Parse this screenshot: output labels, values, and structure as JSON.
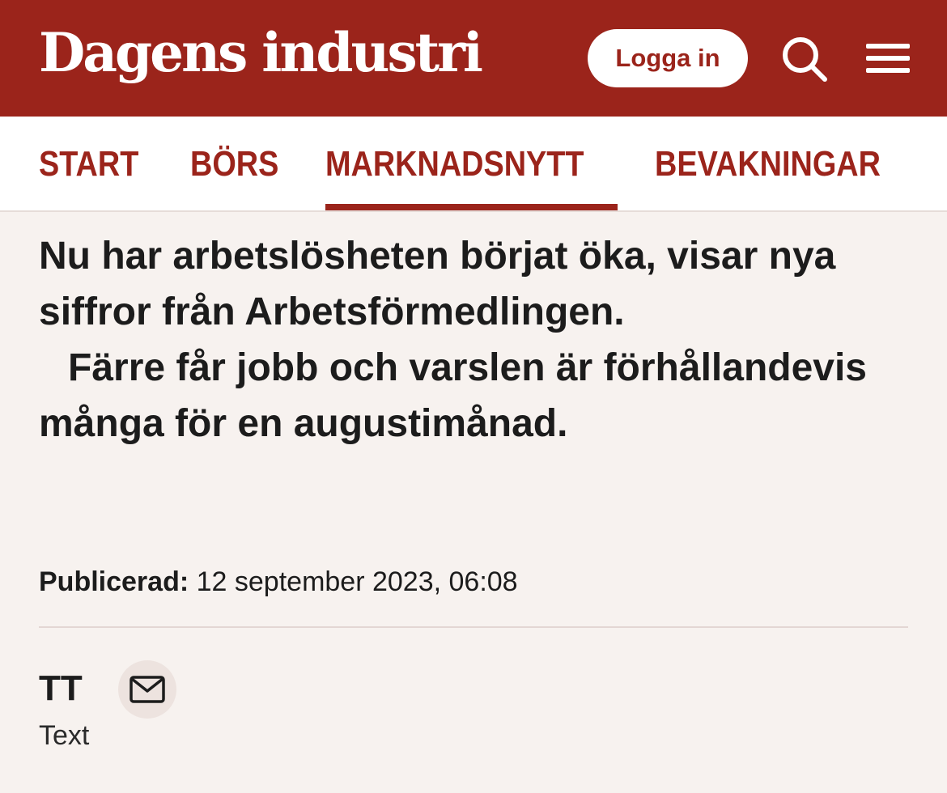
{
  "header": {
    "logo_text": "Dagens industri",
    "login_label": "Logga in",
    "search_icon": "search-icon",
    "menu_icon": "hamburger-menu-icon",
    "brand_color": "#9b241b"
  },
  "nav": {
    "items": [
      {
        "label": "START",
        "active": false
      },
      {
        "label": "BÖRS",
        "active": false
      },
      {
        "label": "MARKNADSNYTT",
        "active": true
      },
      {
        "label": "BEVAKNINGAR",
        "active": false
      }
    ]
  },
  "article": {
    "headline_part1": "Nu har arbetslösheten börjat öka, visar nya siffror från Arbetsförmedlingen.",
    "headline_part2": "Färre får jobb och varslen är förhållandevis många för en augustimånad.",
    "published_label": "Publicerad:",
    "published_date": "12 september 2023, 06:08",
    "author_name": "TT",
    "author_role": "Text",
    "mail_icon": "mail-icon"
  }
}
